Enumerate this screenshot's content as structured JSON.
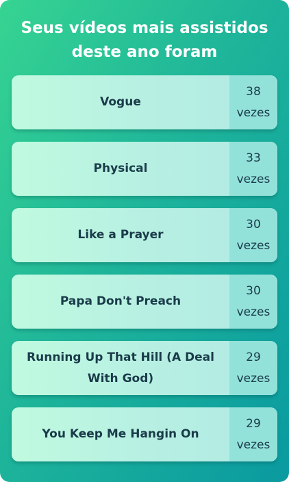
{
  "header": {
    "title_line1": "Seus vídeos mais assistidos",
    "title_line2": "deste ano foram"
  },
  "videos": [
    {
      "title": "Vogue",
      "count": "38",
      "unit": "vezes"
    },
    {
      "title": "Physical",
      "count": "33",
      "unit": "vezes"
    },
    {
      "title": "Like a Prayer",
      "count": "30",
      "unit": "vezes"
    },
    {
      "title": "Papa Don't Preach",
      "count": "30",
      "unit": "vezes"
    },
    {
      "title": "Running Up That Hill (A Deal With God)",
      "count": "29",
      "unit": "vezes"
    },
    {
      "title": "You Keep Me Hangin On",
      "count": "29",
      "unit": "vezes"
    }
  ],
  "colors": {
    "gradient_start": "#36d492",
    "gradient_end": "#0a9aa0",
    "item_background": "#c0fae0",
    "count_background": "#93e2da",
    "text_dark": "#1a3b4a"
  }
}
